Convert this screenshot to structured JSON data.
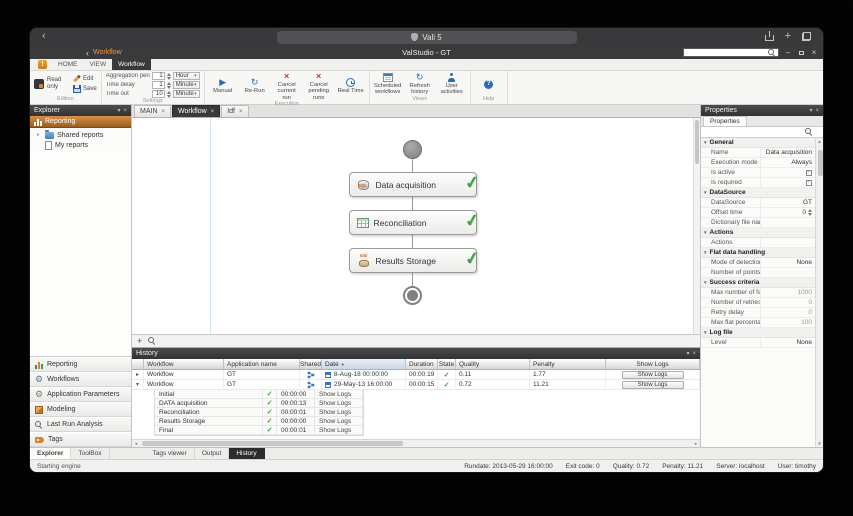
{
  "frame": {
    "back_label": "‹",
    "address_text": "Vali 5"
  },
  "titlebar": {
    "quick_access": "Workflow",
    "title": "ValStudio - GT"
  },
  "ribbon_tabs": {
    "home": "HOME",
    "view": "VIEW",
    "workflow": "Workflow"
  },
  "ribbon": {
    "edition": {
      "label": "Edition",
      "read_only": "Read only",
      "edit": "Edit",
      "save": "Save"
    },
    "settings": {
      "label": "Settings",
      "rows": [
        {
          "label": "Aggregation period",
          "value": "1",
          "unit": "Hour"
        },
        {
          "label": "Time delay",
          "value": "1",
          "unit": "Minute"
        },
        {
          "label": "Time out",
          "value": "10",
          "unit": "Minute"
        }
      ]
    },
    "execution": {
      "label": "Execution",
      "buttons": [
        "Manual",
        "Re-Run",
        "Cancel current run",
        "Cancel pending runs",
        "Real Time"
      ]
    },
    "views": {
      "label": "Views",
      "buttons": [
        "Scheduled workflows",
        "Refresh history",
        "User activities"
      ]
    },
    "help": {
      "label": "Help"
    }
  },
  "explorer": {
    "title": "Explorer",
    "selected": "Reporting",
    "tree": [
      {
        "label": "Shared reports"
      },
      {
        "label": "My reports"
      }
    ],
    "stack": [
      "Reporting",
      "Workflows",
      "Application Parameters",
      "Modeling",
      "Last Run Analysis",
      "Tags"
    ]
  },
  "doc_tabs": [
    {
      "label": "MAIN"
    },
    {
      "label": "Workflow"
    },
    {
      "label": "Idf"
    }
  ],
  "workflow_canvas": {
    "nodes": [
      {
        "label": "Data acquisition",
        "icon_text": "SQL"
      },
      {
        "label": "Reconciliation",
        "icon_text": ""
      },
      {
        "label": "Results Storage",
        "icon_text": "Vali"
      }
    ]
  },
  "history": {
    "title": "History",
    "columns": [
      "Workflow",
      "Application name",
      "Shared",
      "Date",
      "Duration",
      "State",
      "Quality",
      "Penalty",
      "Show Logs"
    ],
    "show_logs_label": "Show Logs",
    "rows": [
      {
        "workflow": "Workflow",
        "application": "GT",
        "date": "8-Aug-18 00:00:00",
        "duration": "00:00:19",
        "quality": "0.11",
        "penalty": "1.77"
      },
      {
        "workflow": "Workflow",
        "application": "GT",
        "date": "29-May-13 16:00:00",
        "duration": "00:00:15",
        "quality": "0.72",
        "penalty": "11.21"
      }
    ],
    "steps": [
      {
        "name": "Initial",
        "duration": "00:00:00"
      },
      {
        "name": "DATA acquisition",
        "duration": "00:00:13"
      },
      {
        "name": "Reconciliation",
        "duration": "00:00:01"
      },
      {
        "name": "Results Storage",
        "duration": "00:00:00"
      },
      {
        "name": "Final",
        "duration": "00:00:01"
      }
    ]
  },
  "properties": {
    "title": "Properties",
    "tab": "Properties",
    "sections": [
      {
        "title": "General",
        "rows": [
          {
            "label": "Name",
            "value": "Data acquisition"
          },
          {
            "label": "Execution mode",
            "value": "Always"
          },
          {
            "label": "Is active",
            "value": ""
          },
          {
            "label": "Is required",
            "value": ""
          }
        ]
      },
      {
        "title": "DataSource",
        "rows": [
          {
            "label": "DataSource",
            "value": "GT"
          },
          {
            "label": "Offset time",
            "value": "0"
          },
          {
            "label": "Dictionary file name",
            "value": ""
          }
        ]
      },
      {
        "title": "Actions",
        "rows": [
          {
            "label": "Actions",
            "value": ""
          }
        ]
      },
      {
        "title": "Flat data handling",
        "rows": [
          {
            "label": "Mode of detection",
            "value": "None"
          },
          {
            "label": "Number of points",
            "value": ""
          }
        ]
      },
      {
        "title": "Success criteria",
        "rows": [
          {
            "label": "Max number of fails",
            "value": "1000"
          },
          {
            "label": "Number of retries",
            "value": "0"
          },
          {
            "label": "Retry delay",
            "value": "0"
          },
          {
            "label": "Max flat percentage",
            "value": "100"
          }
        ]
      },
      {
        "title": "Log file",
        "rows": [
          {
            "label": "Level",
            "value": "None"
          }
        ]
      }
    ]
  },
  "bottom_tabs": {
    "left": [
      "Explorer",
      "ToolBox"
    ],
    "center": [
      "Tags viewer",
      "Output",
      "History"
    ]
  },
  "statusbar": {
    "engine": "Starting engine",
    "items": [
      "Rundate: 2013-05-29 16:00:00",
      "Exit code: 0",
      "Quality: 0.72",
      "Penalty: 11.21",
      "Server: localhost",
      "User: timothy"
    ]
  },
  "icons": {
    "check": "✓",
    "close": "×",
    "chevron_down": "▾",
    "chevron_right": "▸",
    "back": "‹",
    "minimize": "–",
    "plus": "+",
    "gear": "⚙",
    "refresh": "↻",
    "play": "▶",
    "cancel": "×",
    "help": "?",
    "logo": "!",
    "up": "▲",
    "down": "▼",
    "left": "◂",
    "right": "▸"
  },
  "colors": {
    "accent": "#c8782a",
    "success": "#3aa53a",
    "panel_header": "#3b3b3c",
    "blue": "#2a6db5"
  }
}
